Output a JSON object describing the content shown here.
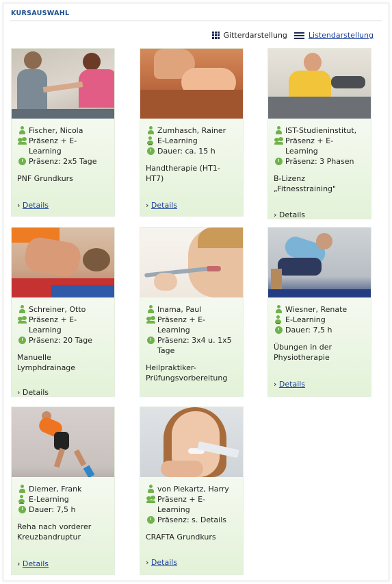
{
  "header": {
    "title": "KURSAUSWAHL"
  },
  "view_toggle": {
    "grid_label": "Gitterdarstellung",
    "list_label": "Listendarstellung"
  },
  "details_prefix": "›",
  "courses": [
    {
      "photo_icon": "physiotherapy-photo",
      "lines": [
        {
          "icon": "person-icon",
          "text": "Fischer, Nicola"
        },
        {
          "icon": "group-icon",
          "text": "Präsenz + E-\nLearning"
        },
        {
          "icon": "clock-icon",
          "text": "Präsenz: 2x5 Tage"
        }
      ],
      "title": "PNF Grundkurs",
      "details": "Details"
    },
    {
      "photo_icon": "hand-therapy-photo",
      "lines": [
        {
          "icon": "person-icon",
          "text": "Zumhasch, Rainer"
        },
        {
          "icon": "e-learning-icon",
          "text": "E-Learning"
        },
        {
          "icon": "clock-icon",
          "text": "Dauer: ca. 15 h"
        }
      ],
      "title": "Handtherapie (HT1-\nHT7)",
      "details": "Details"
    },
    {
      "photo_icon": "fitness-photo",
      "lines": [
        {
          "icon": "person-icon",
          "text": "IST-Studieninstitut,"
        },
        {
          "icon": "group-icon",
          "text": "Präsenz + E-\nLearning"
        },
        {
          "icon": "clock-icon",
          "text": "Präsenz: 3 Phasen"
        }
      ],
      "title": "B-Lizenz\n„Fitnesstraining\"",
      "details": "Details"
    },
    {
      "photo_icon": "lymph-drainage-photo",
      "lines": [
        {
          "icon": "person-icon",
          "text": "Schreiner, Otto"
        },
        {
          "icon": "group-icon",
          "text": "Präsenz + E-\nLearning"
        },
        {
          "icon": "clock-icon",
          "text": "Präsenz: 20 Tage"
        }
      ],
      "title": "Manuelle\nLymphdrainage",
      "details": "Details"
    },
    {
      "photo_icon": "thermometer-photo",
      "lines": [
        {
          "icon": "person-icon",
          "text": "Inama, Paul"
        },
        {
          "icon": "group-icon",
          "text": "Präsenz + E-\nLearning"
        },
        {
          "icon": "clock-icon",
          "text": "Präsenz: 3x4 u. 1x5\nTage"
        }
      ],
      "title": "Heilpraktiker-\nPrüfungsvorbereitung",
      "details": "Details"
    },
    {
      "photo_icon": "stretching-photo",
      "lines": [
        {
          "icon": "person-icon",
          "text": "Wiesner, Renate"
        },
        {
          "icon": "e-learning-icon",
          "text": "E-Learning"
        },
        {
          "icon": "clock-icon",
          "text": "Dauer: 7,5 h"
        }
      ],
      "title": "Übungen in der\nPhysiotherapie",
      "details": "Details"
    },
    {
      "photo_icon": "knee-rehab-photo",
      "lines": [
        {
          "icon": "person-icon",
          "text": "Diemer, Frank"
        },
        {
          "icon": "e-learning-icon",
          "text": "E-Learning"
        },
        {
          "icon": "clock-icon",
          "text": "Dauer: 7,5 h"
        }
      ],
      "title": "Reha nach vorderer\nKreuzbandruptur",
      "details": "Details"
    },
    {
      "photo_icon": "jaw-measure-photo",
      "lines": [
        {
          "icon": "person-icon",
          "text": "von Piekartz, Harry"
        },
        {
          "icon": "group-icon",
          "text": "Präsenz + E-\nLearning"
        },
        {
          "icon": "clock-icon",
          "text": "Präsenz: s. Details"
        }
      ],
      "title": "CRAFTA Grundkurs",
      "details": "Details"
    }
  ]
}
